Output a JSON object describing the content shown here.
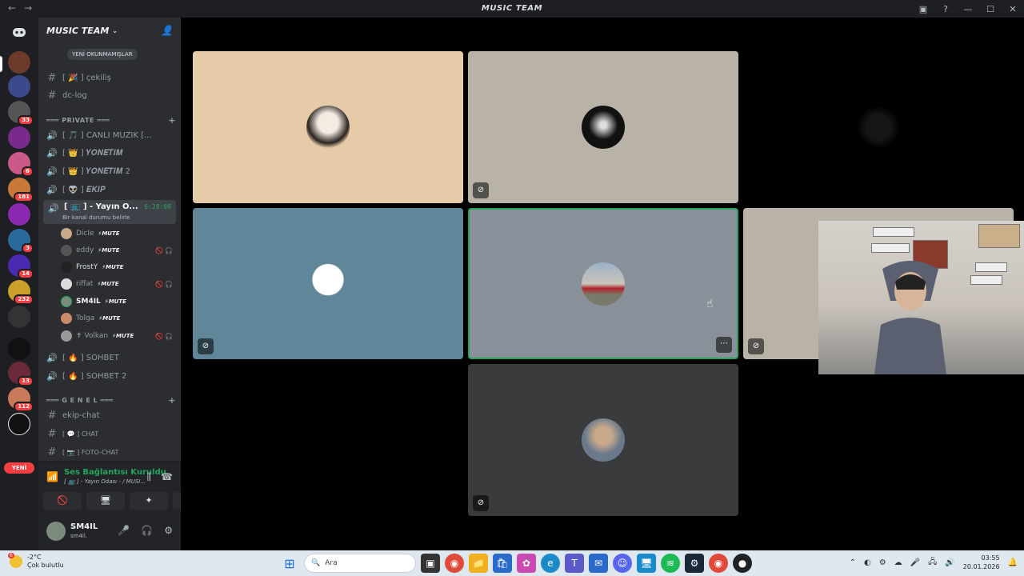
{
  "window": {
    "title": "MUSIC TEAM",
    "nav_back": "←",
    "nav_forward": "→",
    "controls": [
      "▣",
      "?",
      "—",
      "☐",
      "✕"
    ]
  },
  "server": {
    "name": "MUSIC TEAM",
    "unread_label": "YENİ OKUNMAMIŞLAR"
  },
  "servers_rail": {
    "badges": [
      "33",
      "6",
      "181",
      "3",
      "14",
      "232",
      "13",
      "112"
    ],
    "yeni_label": "YENİ"
  },
  "channels": {
    "top": [
      {
        "type": "text",
        "name": "[ 🎉 ] çekiliş"
      },
      {
        "type": "text",
        "name": "dc-log"
      }
    ],
    "private_category": "═══ PRIVATE ═══",
    "voice": [
      {
        "name": "[ 🎵 ] CANLI MÜZİK [..."
      },
      {
        "name": "[ 👑 ] 𝒀𝑶𝑵𝑬𝑻𝑰𝑴"
      },
      {
        "name": "[ 👑 ] 𝒀𝑶𝑵𝑬𝑻𝑰𝑴 2"
      },
      {
        "name": "[ 👽 ] 𝑬𝑲𝑰𝑷"
      }
    ],
    "active": {
      "name": "[ 📺 ] - Yayın O...",
      "timer": "6:28:08",
      "status": "Bir kanal durumu belirle"
    },
    "members": [
      {
        "name": "Dicle",
        "mute": "⚡MUTE"
      },
      {
        "name": "eddy",
        "mute": "⚡MUTE"
      },
      {
        "name": "FrostY",
        "mute": "⚡MUTE"
      },
      {
        "name": "riffat",
        "mute": "⚡MUTE"
      },
      {
        "name": "SM4IL",
        "mute": "⚡MUTE"
      },
      {
        "name": "Tolga",
        "mute": "⚡MUTE"
      },
      {
        "name": "✝ Volkan",
        "mute": "⚡MUTE"
      }
    ],
    "after_voice": [
      {
        "name": "[ 🔥 ] SOHBET"
      },
      {
        "name": "[ 🔥 ] SOHBET 2"
      }
    ],
    "genel_category": "═══ G E N E L ═══",
    "genel_text": [
      {
        "name": "ekip-chat"
      },
      {
        "name": "[ 💬 ] CHAT"
      },
      {
        "name": "[ 📷 ] FOTO-CHAT"
      }
    ]
  },
  "voice_panel": {
    "status": "Ses Bağlantısı Kuruldu",
    "channel": "[ 📺 ] - Yayın Odası - / MUSI..."
  },
  "user_panel": {
    "name": "SM4IL",
    "tag": "sm4il."
  },
  "taskbar": {
    "weather_badge": "6",
    "temperature": "-2°C",
    "condition": "Çok bulutlu",
    "search_placeholder": "Ara",
    "time": "03:55",
    "date": "20.01.2026"
  },
  "colors": {
    "accent_green": "#23a55a",
    "badge_red": "#f23f43",
    "sidebar_bg": "#2b2d31",
    "rail_bg": "#1e1f22"
  }
}
